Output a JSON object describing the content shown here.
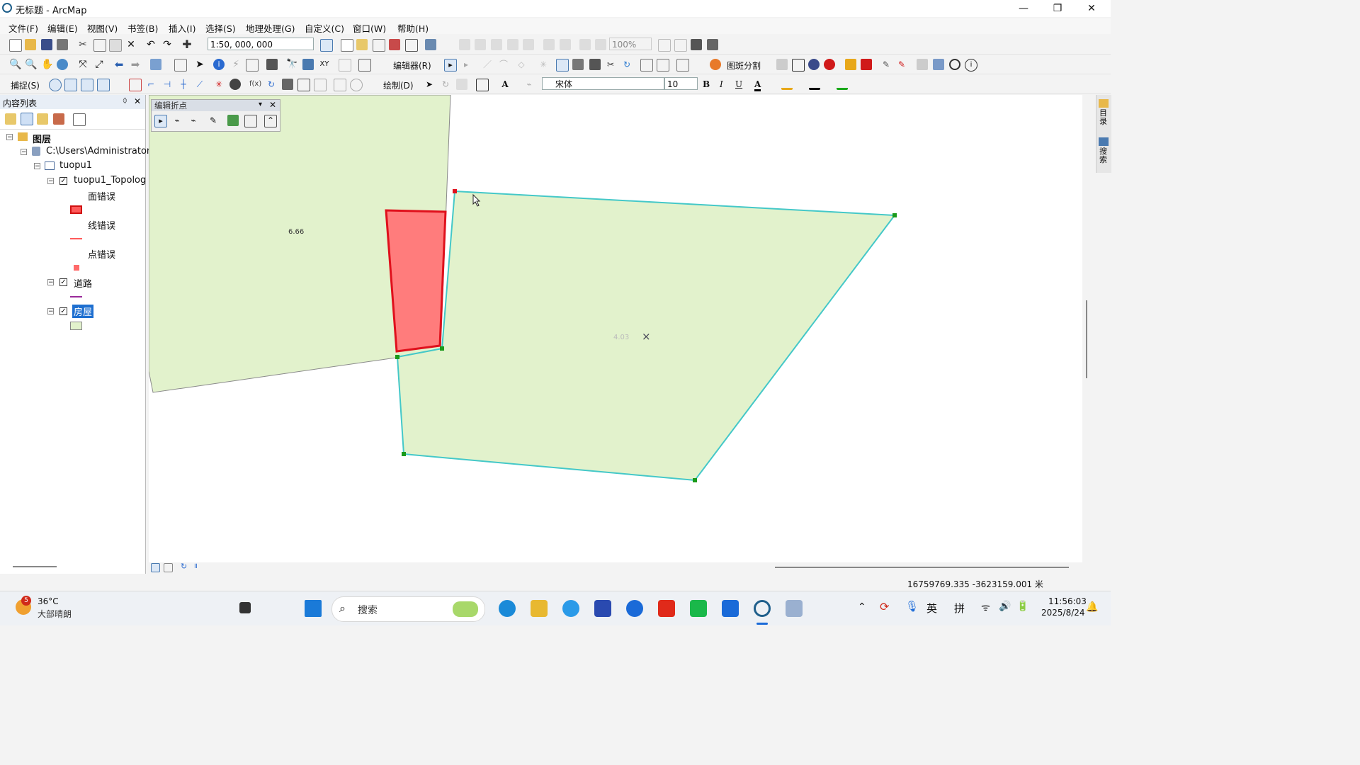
{
  "window": {
    "title": "无标题 - ArcMap",
    "minimize": "—",
    "restore": "❐",
    "close": "✕"
  },
  "menu": [
    "文件(F)",
    "编辑(E)",
    "视图(V)",
    "书签(B)",
    "插入(I)",
    "选择(S)",
    "地理处理(G)",
    "自定义(C)",
    "窗口(W)",
    "帮助(H)"
  ],
  "toolbar": {
    "scale": "1:50, 000, 000",
    "zoom_percent": "100%",
    "editor_label": "编辑器(R)",
    "spot_split": "图斑分割",
    "snap_label": "捕捉(S)",
    "draw_label": "绘制(D)",
    "font_name": "宋体",
    "font_size": "10",
    "bold": "B",
    "italic": "I",
    "underline": "U",
    "font_color": "A"
  },
  "toc": {
    "header": "内容列表",
    "pin": "ᛰ",
    "close": "✕",
    "root": "图层",
    "gdb": "C:\\Users\\Administrator",
    "dataset": "tuopu1",
    "topology": "tuopu1_Topolog",
    "polygon_error": "面错误",
    "line_error": "线错误",
    "point_error": "点错误",
    "road": "道路",
    "house": "房屋"
  },
  "edit_vertices": {
    "title": "编辑折点"
  },
  "map": {
    "label_left": "6.66",
    "label_right": "4.03",
    "cursor_mark": "×"
  },
  "right_dock": {
    "tab1": "目录",
    "tab2": "搜索"
  },
  "status": {
    "coords": "16759769.335  -3623159.001 米"
  },
  "taskbar": {
    "weather_temp": "36°C",
    "weather_desc": "大部晴朗",
    "weather_badge": "5",
    "search": "搜索",
    "ime1": "英",
    "ime2": "拼",
    "time": "11:56:03",
    "date": "2025/8/24"
  },
  "colors": {
    "poly_fill": "#e2f2cc",
    "poly_edge": "#44c8c8",
    "error_fill": "#ff7c7c",
    "error_edge": "#e0101c",
    "vertex": "#1a9a1a",
    "selected_layer": "#1e6fd0"
  }
}
